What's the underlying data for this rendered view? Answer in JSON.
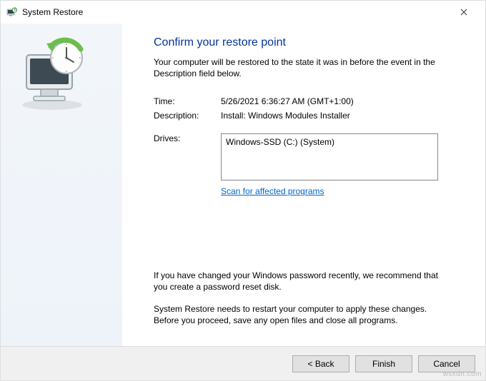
{
  "titlebar": {
    "title": "System Restore"
  },
  "main": {
    "heading": "Confirm your restore point",
    "subtext": "Your computer will be restored to the state it was in before the event in the Description field below.",
    "time_label": "Time:",
    "time_value": "5/26/2021 6:36:27 AM (GMT+1:00)",
    "description_label": "Description:",
    "description_value": "Install: Windows Modules Installer",
    "drives_label": "Drives:",
    "drives_value": "Windows-SSD (C:) (System)",
    "scan_link": "Scan for affected programs",
    "note1": "If you have changed your Windows password recently, we recommend that you create a password reset disk.",
    "note2": "System Restore needs to restart your computer to apply these changes. Before you proceed, save any open files and close all programs."
  },
  "footer": {
    "back": "< Back",
    "finish": "Finish",
    "cancel": "Cancel"
  },
  "watermark": "wsxdn.com"
}
